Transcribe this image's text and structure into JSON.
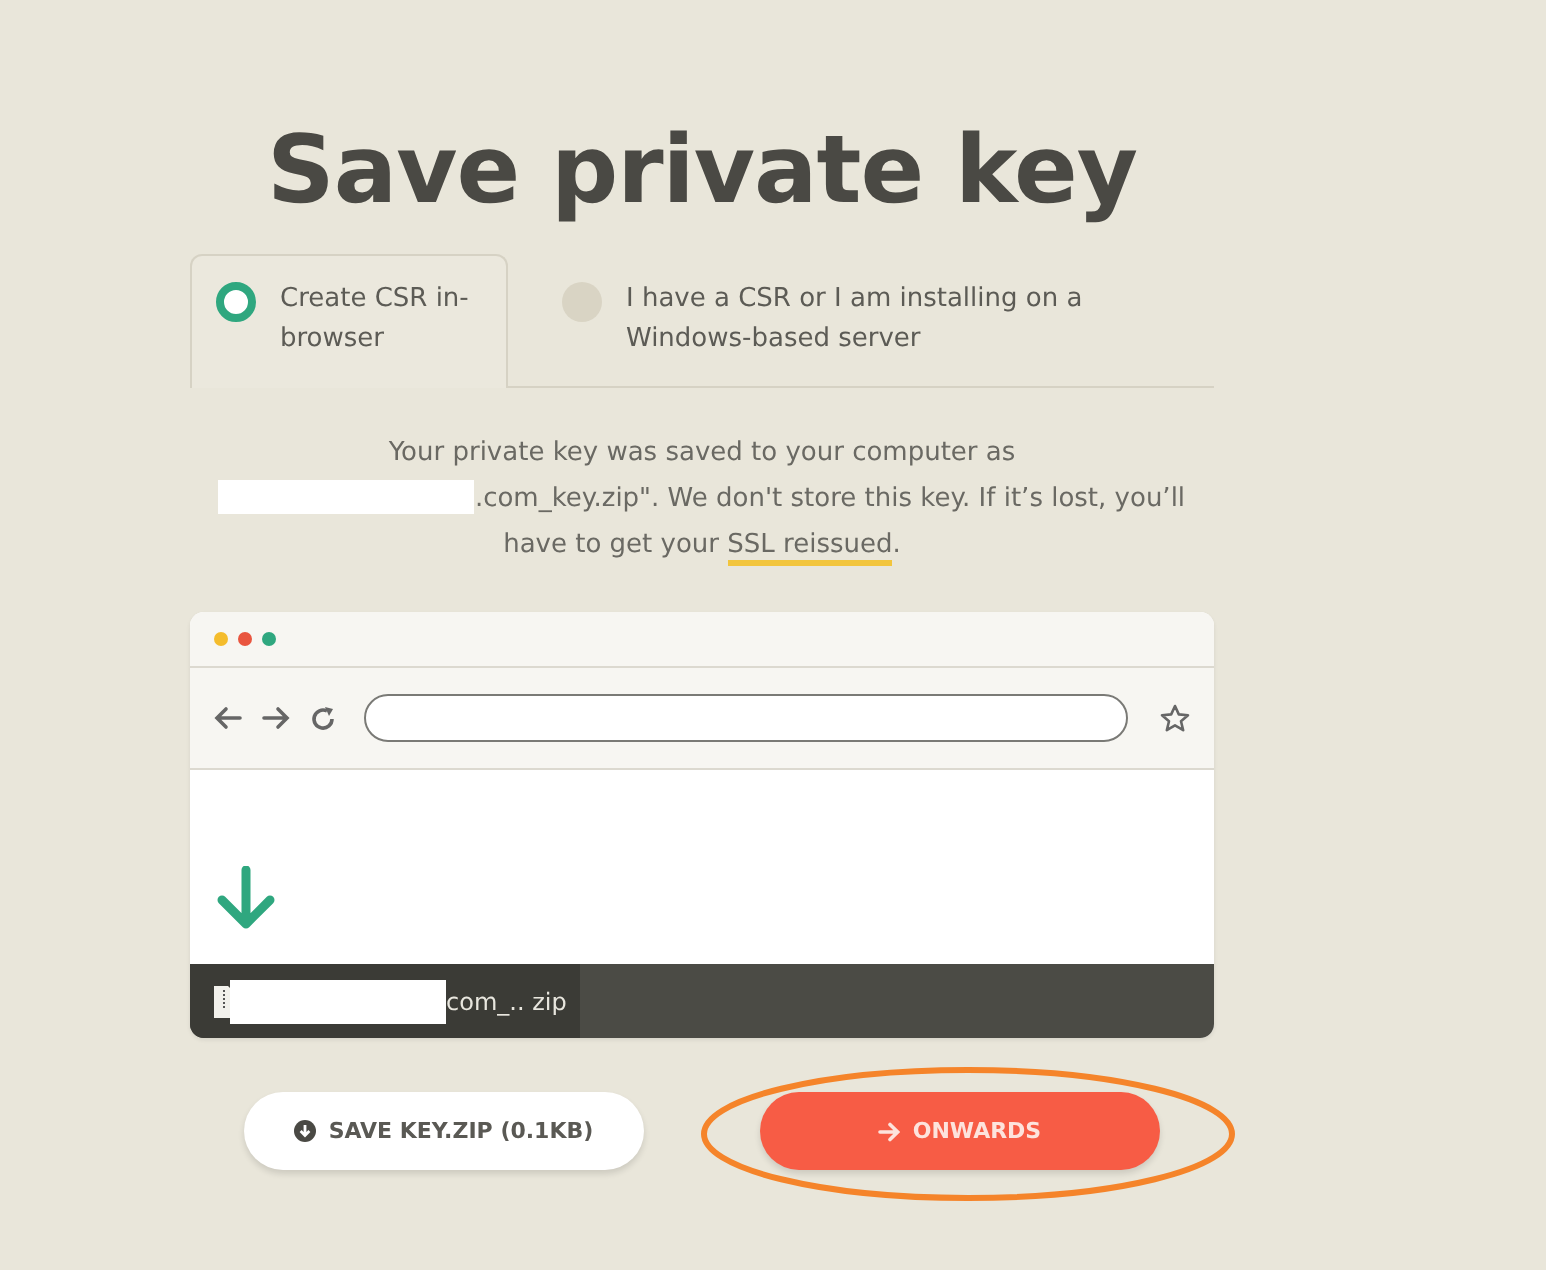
{
  "title": "Save private key",
  "tabs": [
    {
      "label": "Create CSR in-browser",
      "selected": true
    },
    {
      "label": "I have a CSR or I am installing on a Windows-based server",
      "selected": false
    }
  ],
  "message": {
    "first_line": "Your private key was saved to your computer as",
    "after_redaction": ".com_key.zip\". We don't store this key. If it’s lost, you’ll have to get your",
    "link": "SSL reissued",
    "end": "."
  },
  "browser": {
    "download_name": "com_.. zip"
  },
  "buttons": [
    {
      "kind": "secondary",
      "label": "SAVE KEY.ZIP (0.1KB)",
      "highlighted": false
    },
    {
      "kind": "primary",
      "label": "ONWARDS",
      "highlighted": true
    }
  ]
}
